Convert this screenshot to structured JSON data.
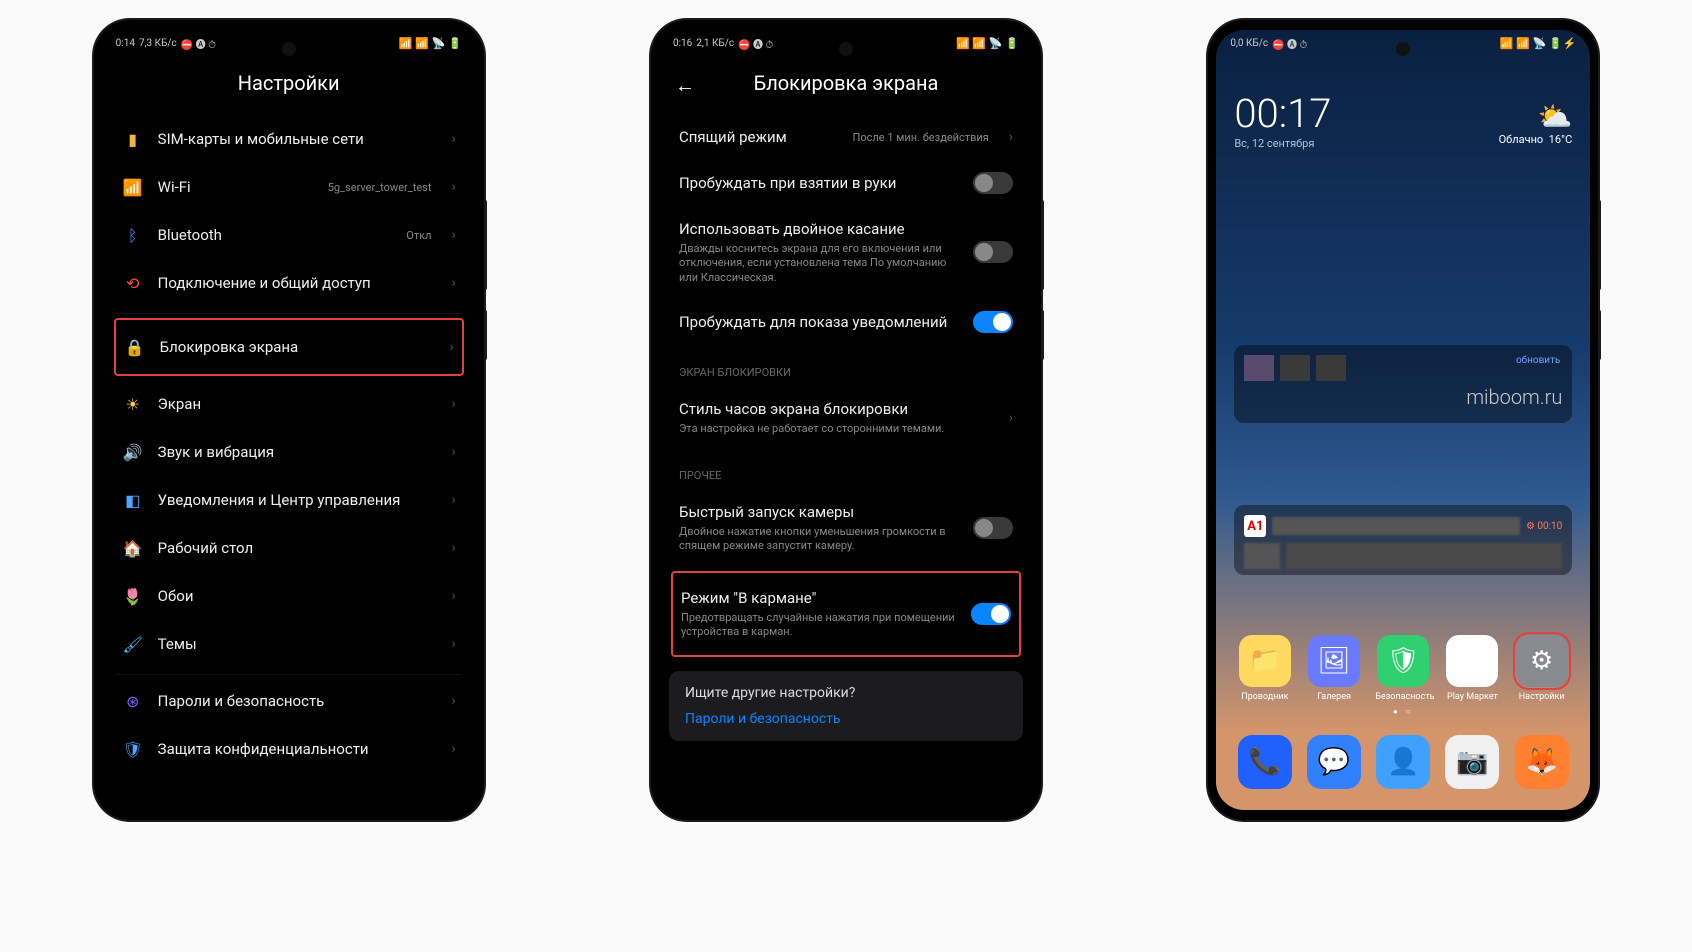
{
  "phone1": {
    "status": {
      "time": "0:14",
      "net": "7,3 КБ/с"
    },
    "title": "Настройки",
    "items": [
      {
        "icon": "sim",
        "color": "#f0b840",
        "label": "SIM-карты и мобильные сети"
      },
      {
        "icon": "wifi",
        "color": "#4aa8ff",
        "label": "Wi-Fi",
        "value": "5g_server_tower_test"
      },
      {
        "icon": "bt",
        "color": "#4a90ff",
        "label": "Bluetooth",
        "value": "Откл"
      },
      {
        "icon": "share",
        "color": "#ff4a4a",
        "label": "Подключение и общий доступ"
      },
      {
        "icon": "lock",
        "color": "#ff5a3a",
        "label": "Блокировка экрана",
        "hl": true
      },
      {
        "icon": "sun",
        "color": "#ffd040",
        "label": "Экран"
      },
      {
        "icon": "sound",
        "color": "#4aff6a",
        "label": "Звук и вибрация"
      },
      {
        "icon": "notif",
        "color": "#4aa8ff",
        "label": "Уведомления и Центр управления"
      },
      {
        "icon": "home",
        "color": "#a060ff",
        "label": "Рабочий стол"
      },
      {
        "icon": "wall",
        "color": "#ff4a7a",
        "label": "Обои"
      },
      {
        "icon": "theme",
        "color": "#4ac0ff",
        "label": "Темы"
      },
      {
        "icon": "pass",
        "color": "#8a60ff",
        "label": "Пароли и безопасность"
      },
      {
        "icon": "priv",
        "color": "#4aa8ff",
        "label": "Защита конфиденциальности"
      }
    ]
  },
  "phone2": {
    "status": {
      "time": "0:16",
      "net": "2,1 КБ/с"
    },
    "title": "Блокировка экрана",
    "groups": {
      "top": [
        {
          "label": "Спящий режим",
          "value": "После 1 мин. бездействия",
          "chev": true
        },
        {
          "label": "Пробуждать при взятии в руки",
          "toggle": "off"
        },
        {
          "label": "Использовать двойное касание",
          "sub": "Дважды коснитесь экрана для его включения или отключения, если установлена тема По умолчанию или Классическая.",
          "toggle": "off"
        },
        {
          "label": "Пробуждать для показа уведомлений",
          "toggle": "on"
        }
      ],
      "hdr1": "ЭКРАН БЛОКИРОВКИ",
      "mid": [
        {
          "label": "Стиль часов экрана блокировки",
          "sub": "Эта настройка не работает со сторонними темами.",
          "chev": true
        }
      ],
      "hdr2": "ПРОЧЕЕ",
      "bot": [
        {
          "label": "Быстрый запуск камеры",
          "sub": "Двойное нажатие кнопки уменьшения громкости в спящем режиме запустит камеру.",
          "toggle": "off"
        },
        {
          "label": "Режим \"В кармане\"",
          "sub": "Предотвращать случайные нажатия при помещении устройства в карман.",
          "toggle": "on",
          "hl": true
        }
      ]
    },
    "hint": {
      "q": "Ищите другие настройки?",
      "a": "Пароли и безопасность"
    }
  },
  "phone3": {
    "status": {
      "net": "0,0 КБ/с"
    },
    "clock": {
      "time": "00:17",
      "date": "Вс, 12 сентября"
    },
    "weather": {
      "text": "Облачно",
      "temp": "16°C"
    },
    "widget1": {
      "update": "обновить",
      "text": "miboom.ru"
    },
    "apps": [
      {
        "name": "Проводник",
        "bg": "#ffd860",
        "glyph": "📁"
      },
      {
        "name": "Галерея",
        "bg": "#6a7aff",
        "glyph": "🖼"
      },
      {
        "name": "Безопасность",
        "bg": "#30d070",
        "glyph": "🛡"
      },
      {
        "name": "Play Маркет",
        "bg": "#ffffff",
        "glyph": "▶"
      },
      {
        "name": "Настройки",
        "bg": "#888a90",
        "glyph": "⚙",
        "hl": true
      }
    ],
    "dock": [
      {
        "bg": "#2060ff",
        "glyph": "📞"
      },
      {
        "bg": "#3080ff",
        "glyph": "💬"
      },
      {
        "bg": "#40a0ff",
        "glyph": "👤"
      },
      {
        "bg": "#f0f0f0",
        "glyph": "📷"
      },
      {
        "bg": "#ff8030",
        "glyph": "🦊"
      }
    ]
  }
}
